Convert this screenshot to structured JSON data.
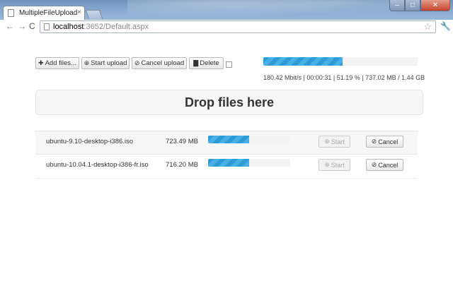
{
  "browser": {
    "tab_title": "MultipleFileUpload",
    "url_host": "localhost",
    "url_rest": ":3652/Default.aspx"
  },
  "toolbar": {
    "add_files": "Add files...",
    "start_upload": "Start upload",
    "cancel_upload": "Cancel upload",
    "delete": "Delete"
  },
  "overall": {
    "progress": 0.5119,
    "stats": "180.42 Mbit/s | 00:00:31 | 51.19 % | 737.02 MB / 1.44 GB"
  },
  "dropzone": {
    "label": "Drop files here"
  },
  "files": [
    {
      "name": "ubuntu-9.10-desktop-i386.iso",
      "size": "723.49 MB",
      "progress": 0.5,
      "start": "Start",
      "cancel": "Cancel"
    },
    {
      "name": "ubuntu-10.04.1-desktop-i386-fr.iso",
      "size": "716.20 MB",
      "progress": 0.5,
      "start": "Start",
      "cancel": "Cancel"
    }
  ],
  "colors": {
    "progress": "#2d9bd8"
  }
}
